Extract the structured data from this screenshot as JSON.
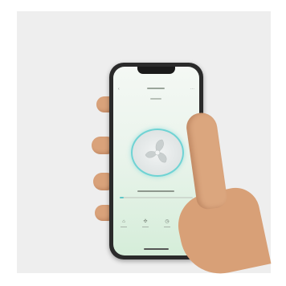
{
  "photo": {
    "subject": "hand-holding-phone",
    "colors": {
      "backdrop": "#eeeeee",
      "skin": "#d9a27a",
      "phone_frame": "#2a2a2a",
      "screen_top": "#f4f8f4",
      "screen_bottom": "#d5edd9",
      "fan_ring": "#6fd3d4"
    }
  },
  "app": {
    "status": {
      "left": "",
      "right": ""
    },
    "fan_level": 0.06,
    "tabs": [
      {
        "icon": "home-icon"
      },
      {
        "icon": "fan-icon"
      },
      {
        "icon": "timer-icon"
      },
      {
        "icon": "settings-icon"
      }
    ]
  }
}
